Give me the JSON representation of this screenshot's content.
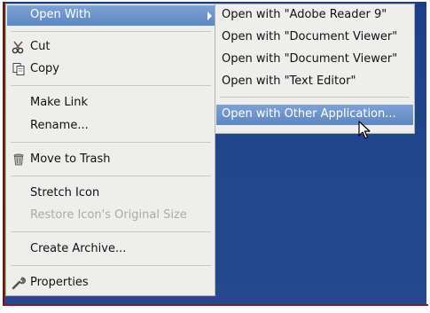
{
  "context_menu": {
    "items": [
      {
        "label": "Open With",
        "has_submenu": true,
        "highlighted": true
      },
      {
        "label": "Cut",
        "icon": "scissors-icon"
      },
      {
        "label": "Copy",
        "icon": "copy-icon"
      },
      {
        "label": "Make Link"
      },
      {
        "label": "Rename..."
      },
      {
        "label": "Move to Trash",
        "icon": "trash-icon"
      },
      {
        "label": "Stretch Icon"
      },
      {
        "label": "Restore Icon's Original Size",
        "disabled": true
      },
      {
        "label": "Create Archive..."
      },
      {
        "label": "Properties",
        "icon": "wrench-icon"
      }
    ]
  },
  "submenu": {
    "items": [
      {
        "label": "Open with \"Adobe Reader 9\""
      },
      {
        "label": "Open with \"Document Viewer\""
      },
      {
        "label": "Open with \"Document Viewer\""
      },
      {
        "label": "Open with \"Text Editor\""
      },
      {
        "label": "Open with Other Application...",
        "highlighted": true
      }
    ]
  },
  "colors": {
    "highlight": "#6a91c9",
    "menu_bg": "#eeeeec",
    "desktop_bg": "#22478f",
    "disabled_text": "#aaaaa6"
  }
}
